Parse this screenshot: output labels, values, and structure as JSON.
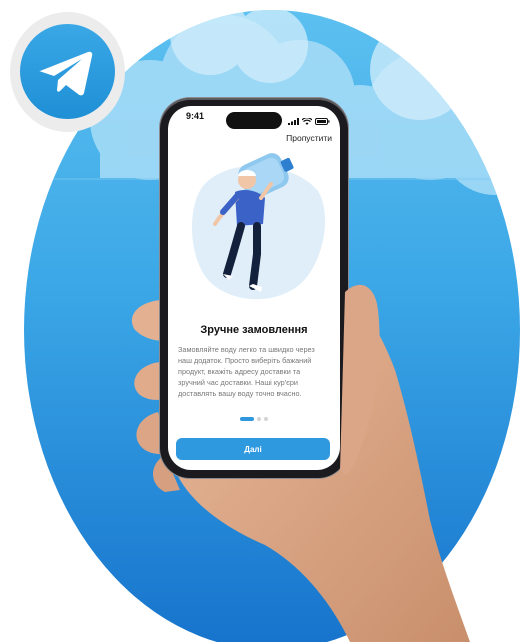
{
  "status_bar": {
    "time": "9:41"
  },
  "onboarding": {
    "skip_label": "Пропустити",
    "title": "Зручне замовлення",
    "description": "Замовляйте воду легко та швидко через наш додаток. Просто виберіть бажаний продукт, вкажіть адресу доставки та зручний час доставки. Наші кур'єри доставлять вашу воду точно вчасно.",
    "next_label": "Далі",
    "pagination": {
      "total": 3,
      "active": 1
    }
  },
  "colors": {
    "accent": "#2f99e0",
    "background_gradient_top": "#53b8ee",
    "background_gradient_bottom": "#1a7fd1",
    "telegram_blue": "#2a9de2"
  },
  "icons": {
    "badge": "telegram-logo-icon",
    "signal": "cellular-signal-icon",
    "wifi": "wifi-icon",
    "battery": "battery-icon"
  }
}
